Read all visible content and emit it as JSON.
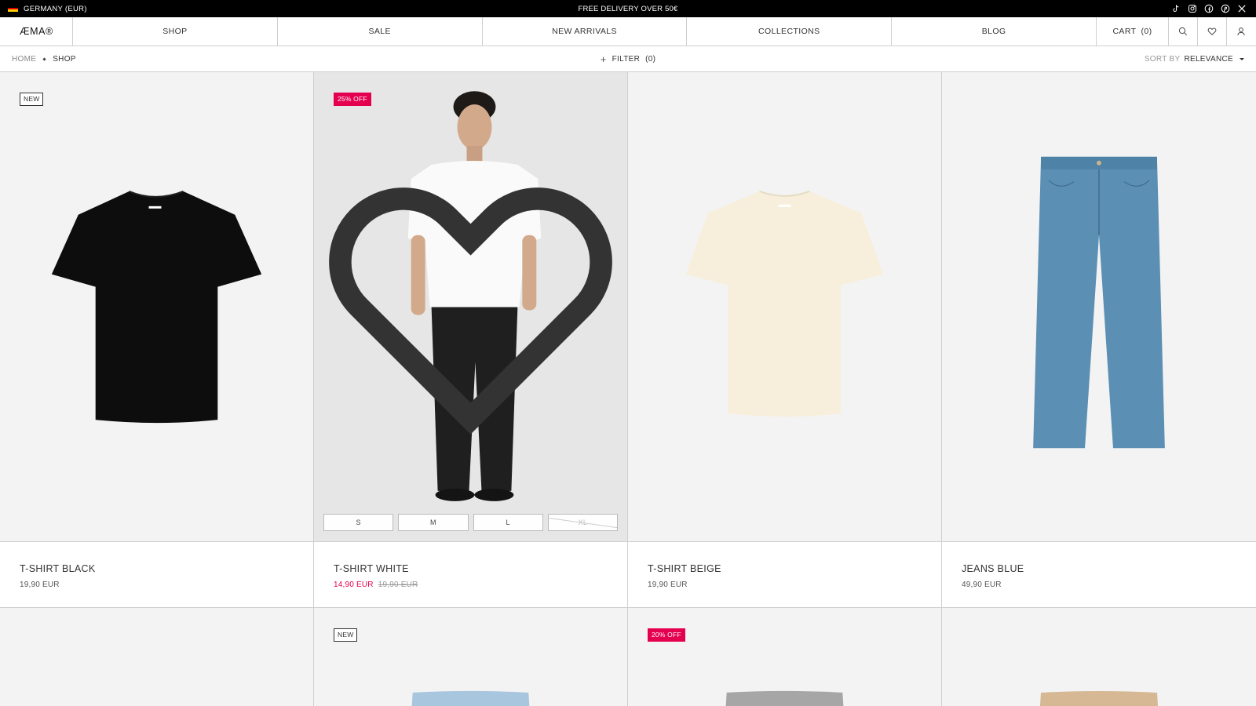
{
  "topbar": {
    "region": "GERMANY (EUR)",
    "promo": "FREE DELIVERY OVER 50€",
    "socials": [
      "tiktok-icon",
      "instagram-icon",
      "facebook-icon",
      "pinterest-icon",
      "x-icon"
    ]
  },
  "nav": {
    "logo": "ÆMA®",
    "links": [
      "SHOP",
      "SALE",
      "NEW ARRIVALS",
      "COLLECTIONS",
      "BLOG"
    ],
    "cart_label": "CART",
    "cart_count": "0"
  },
  "toolbar": {
    "breadcrumb": [
      "HOME",
      "SHOP"
    ],
    "filter_label": "FILTER",
    "filter_count": "0",
    "sort_label": "SORT BY",
    "sort_value": "RELEVANCE"
  },
  "colors": {
    "sale": "#e5004f",
    "topbar": "#000000",
    "border": "#cfcfcf"
  },
  "products": [
    {
      "name": "T-SHIRT BLACK",
      "price": "19,90 EUR",
      "badge": "NEW",
      "color": "#0d0d0d"
    },
    {
      "name": "T-SHIRT WHITE",
      "price": "14,90 EUR",
      "old_price": "19,90 EUR",
      "badge": "25% OFF",
      "sizes": [
        "S",
        "M",
        "L",
        "XL"
      ],
      "unavailable_size": "XL"
    },
    {
      "name": "T-SHIRT BEIGE",
      "price": "19,90 EUR",
      "color": "#f7efdb"
    },
    {
      "name": "JEANS BLUE",
      "price": "49,90 EUR",
      "color": "#5b8fb3"
    }
  ],
  "products_row2": [
    {
      "badge": ""
    },
    {
      "badge": "NEW"
    },
    {
      "badge": "20% OFF"
    },
    {
      "badge": ""
    }
  ]
}
